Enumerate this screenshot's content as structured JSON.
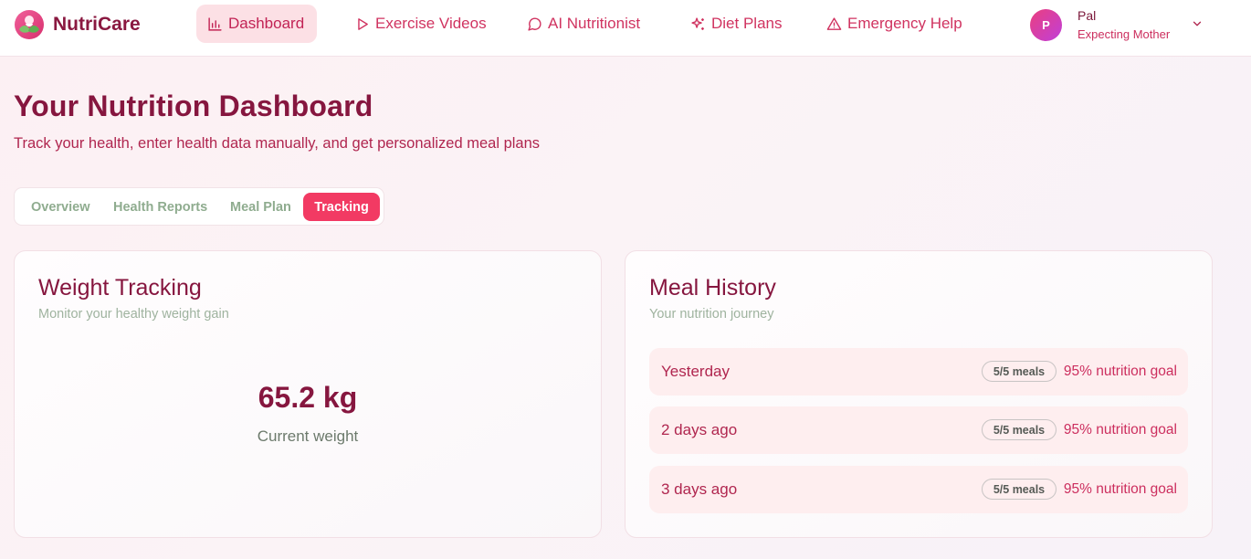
{
  "brand": {
    "name": "NutriCare"
  },
  "nav": {
    "items": [
      {
        "label": "Dashboard",
        "icon": "bar-chart-icon",
        "active": true
      },
      {
        "label": "Exercise Videos",
        "icon": "play-icon",
        "active": false
      },
      {
        "label": "AI Nutritionist",
        "icon": "chat-bubble-icon",
        "active": false
      },
      {
        "label": "Diet Plans",
        "icon": "sparkles-icon",
        "active": false
      },
      {
        "label": "Emergency Help",
        "icon": "warning-triangle-icon",
        "active": false
      }
    ]
  },
  "user": {
    "initial": "P",
    "name": "Pal",
    "role": "Expecting Mother"
  },
  "page": {
    "title": "Your Nutrition Dashboard",
    "subtitle": "Track your health, enter health data manually, and get personalized meal plans"
  },
  "tabs": [
    {
      "label": "Overview",
      "active": false
    },
    {
      "label": "Health Reports",
      "active": false
    },
    {
      "label": "Meal Plan",
      "active": false
    },
    {
      "label": "Tracking",
      "active": true
    }
  ],
  "weight": {
    "title": "Weight Tracking",
    "subtitle": "Monitor your healthy weight gain",
    "value": "65.2 kg",
    "label": "Current weight"
  },
  "meals": {
    "title": "Meal History",
    "subtitle": "Your nutrition journey",
    "rows": [
      {
        "when": "Yesterday",
        "badge": "5/5 meals",
        "goal": "95% nutrition goal"
      },
      {
        "when": "2 days ago",
        "badge": "5/5 meals",
        "goal": "95% nutrition goal"
      },
      {
        "when": "3 days ago",
        "badge": "5/5 meals",
        "goal": "95% nutrition goal"
      }
    ]
  },
  "colors": {
    "primary": "#86163f",
    "accent": "#f23a63",
    "nav_text": "#d03360",
    "nav_active_bg": "#fce0e5",
    "muted_green": "#9fb39f",
    "row_bg": "#feeeef"
  }
}
